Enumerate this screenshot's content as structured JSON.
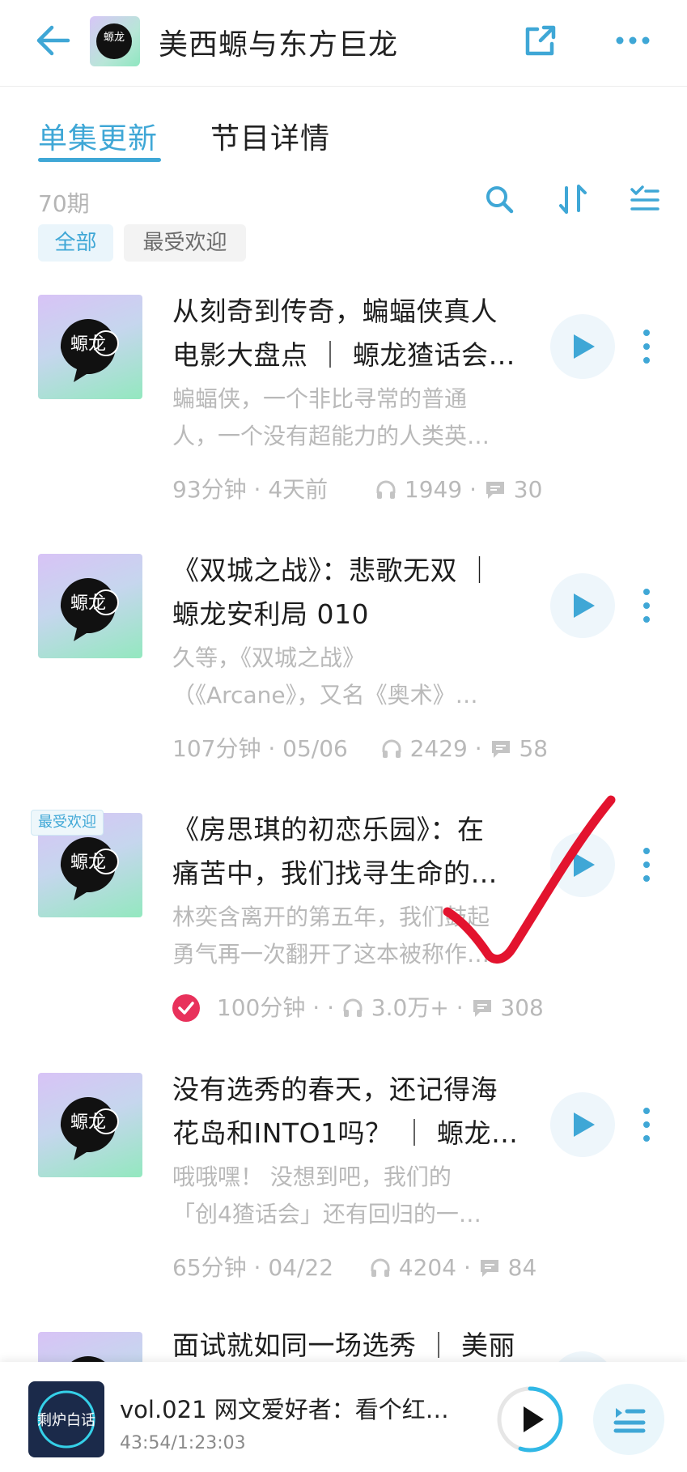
{
  "header": {
    "title": "美西螈与东方巨龙",
    "cover_text": "螈龙"
  },
  "tabs": [
    {
      "label": "单集更新",
      "active": true
    },
    {
      "label": "节目详情",
      "active": false
    }
  ],
  "episode_count": "70期",
  "filters": [
    {
      "label": "全部",
      "active": true
    },
    {
      "label": "最受欢迎",
      "active": false
    }
  ],
  "episodes": [
    {
      "title_lines": [
        "从刻奇到传奇，蝙蝠侠真人",
        "电影大盘点 ｜ 螈龙猹话会…"
      ],
      "desc_lines": [
        "蝙蝠侠，一个非比寻常的普通",
        "人，一个没有超能力的人类英…"
      ],
      "duration": "93分钟",
      "date": "4天前",
      "plays": "1949",
      "comments": "30",
      "badge": "",
      "played": false
    },
    {
      "title_lines": [
        "《双城之战》：悲歌无双 ｜",
        "螈龙安利局 010"
      ],
      "desc_lines": [
        "久等，《双城之战》",
        "（《Arcane》，又名《奥术》…"
      ],
      "duration": "107分钟",
      "date": "05/06",
      "plays": "2429",
      "comments": "58",
      "badge": "",
      "played": false
    },
    {
      "title_lines": [
        "《房思琪的初恋乐园》：在",
        "痛苦中，我们找寻生命的…"
      ],
      "desc_lines": [
        "林奕含离开的第五年，我们鼓起",
        "勇气再一次翻开了这本被称作…"
      ],
      "duration": "100分钟",
      "date": "·",
      "plays": "3.0万+",
      "comments": "308",
      "badge": "最受欢迎",
      "played": true
    },
    {
      "title_lines": [
        "没有选秀的春天，还记得海",
        "花岛和INTO1吗？ ｜ 螈龙…"
      ],
      "desc_lines": [
        "哦哦嘿！ 没想到吧，我们的",
        "「创4猹话会」还有回归的一…"
      ],
      "duration": "65分钟",
      "date": "04/22",
      "plays": "4204",
      "comments": "84",
      "badge": "",
      "played": false
    },
    {
      "title_lines": [
        "面试就如同一场选秀 ｜ 美丽"
      ],
      "desc_lines": [],
      "duration": "",
      "date": "",
      "plays": "",
      "comments": "",
      "badge": "",
      "played": false
    }
  ],
  "player": {
    "title": "vol.021  网文爱好者：看个红…",
    "time": "43:54/1:23:03",
    "cover_text": "剩炉白话",
    "progress": 0.55
  },
  "colors": {
    "accent": "#3fa7d6",
    "annotation": "#e3132e",
    "played_badge": "#e8315b"
  }
}
